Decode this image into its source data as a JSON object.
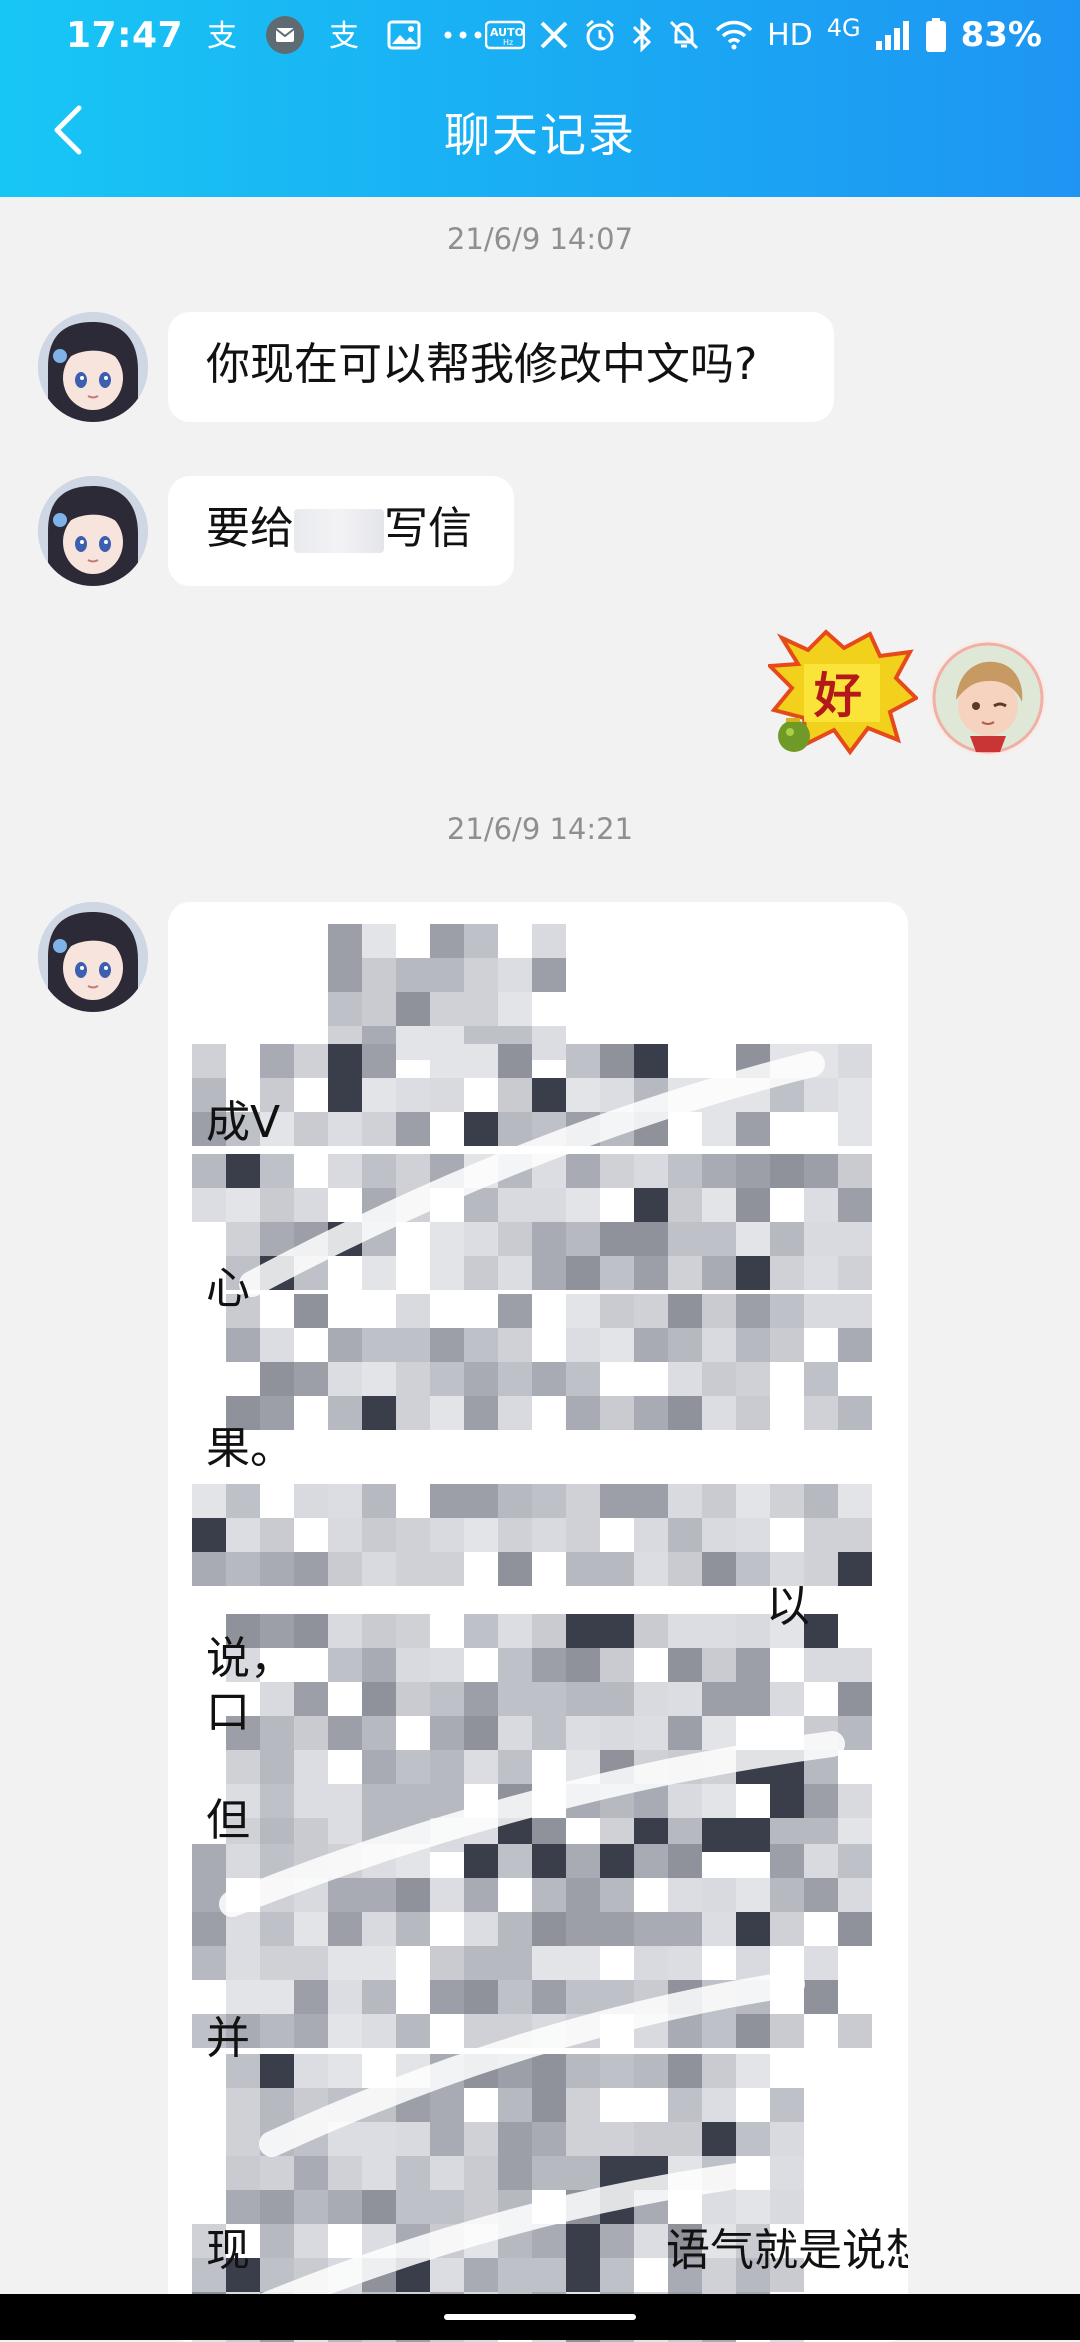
{
  "status_bar": {
    "time": "17:47",
    "network": "HD",
    "cellular": "4G",
    "battery": "83%",
    "icons": [
      "alipay-icon",
      "mail-icon",
      "alipay-icon",
      "gallery-icon",
      "more-icon",
      "auto-hz-icon",
      "x-icon",
      "alarm-icon",
      "bluetooth-icon",
      "mute-icon",
      "wifi-icon",
      "signal-icon",
      "battery-icon"
    ]
  },
  "header": {
    "title": "聊天记录",
    "back_icon": "chevron-left-icon",
    "gradient": [
      "#18c6f5",
      "#1e95f3"
    ]
  },
  "messages": [
    {
      "type": "timestamp",
      "text": "21/6/9 14:07"
    },
    {
      "type": "text",
      "side": "left",
      "text": "你现在可以帮我修改中文吗?"
    },
    {
      "type": "text",
      "side": "left",
      "text_before": "要给",
      "text_after": "写信"
    },
    {
      "type": "sticker",
      "side": "right",
      "text": "好"
    },
    {
      "type": "timestamp",
      "text": "21/6/9 14:21"
    },
    {
      "type": "long_text",
      "side": "left",
      "visible_fragments": [
        "成V",
        "心",
        "果。",
        "以",
        "说，",
        "口",
        "但",
        "并",
        "现",
        "语气就是说想"
      ]
    }
  ],
  "colors": {
    "background": "#f2f2f2",
    "bubble": "#ffffff",
    "text": "#111111",
    "timestamp": "#8f8f8f"
  }
}
